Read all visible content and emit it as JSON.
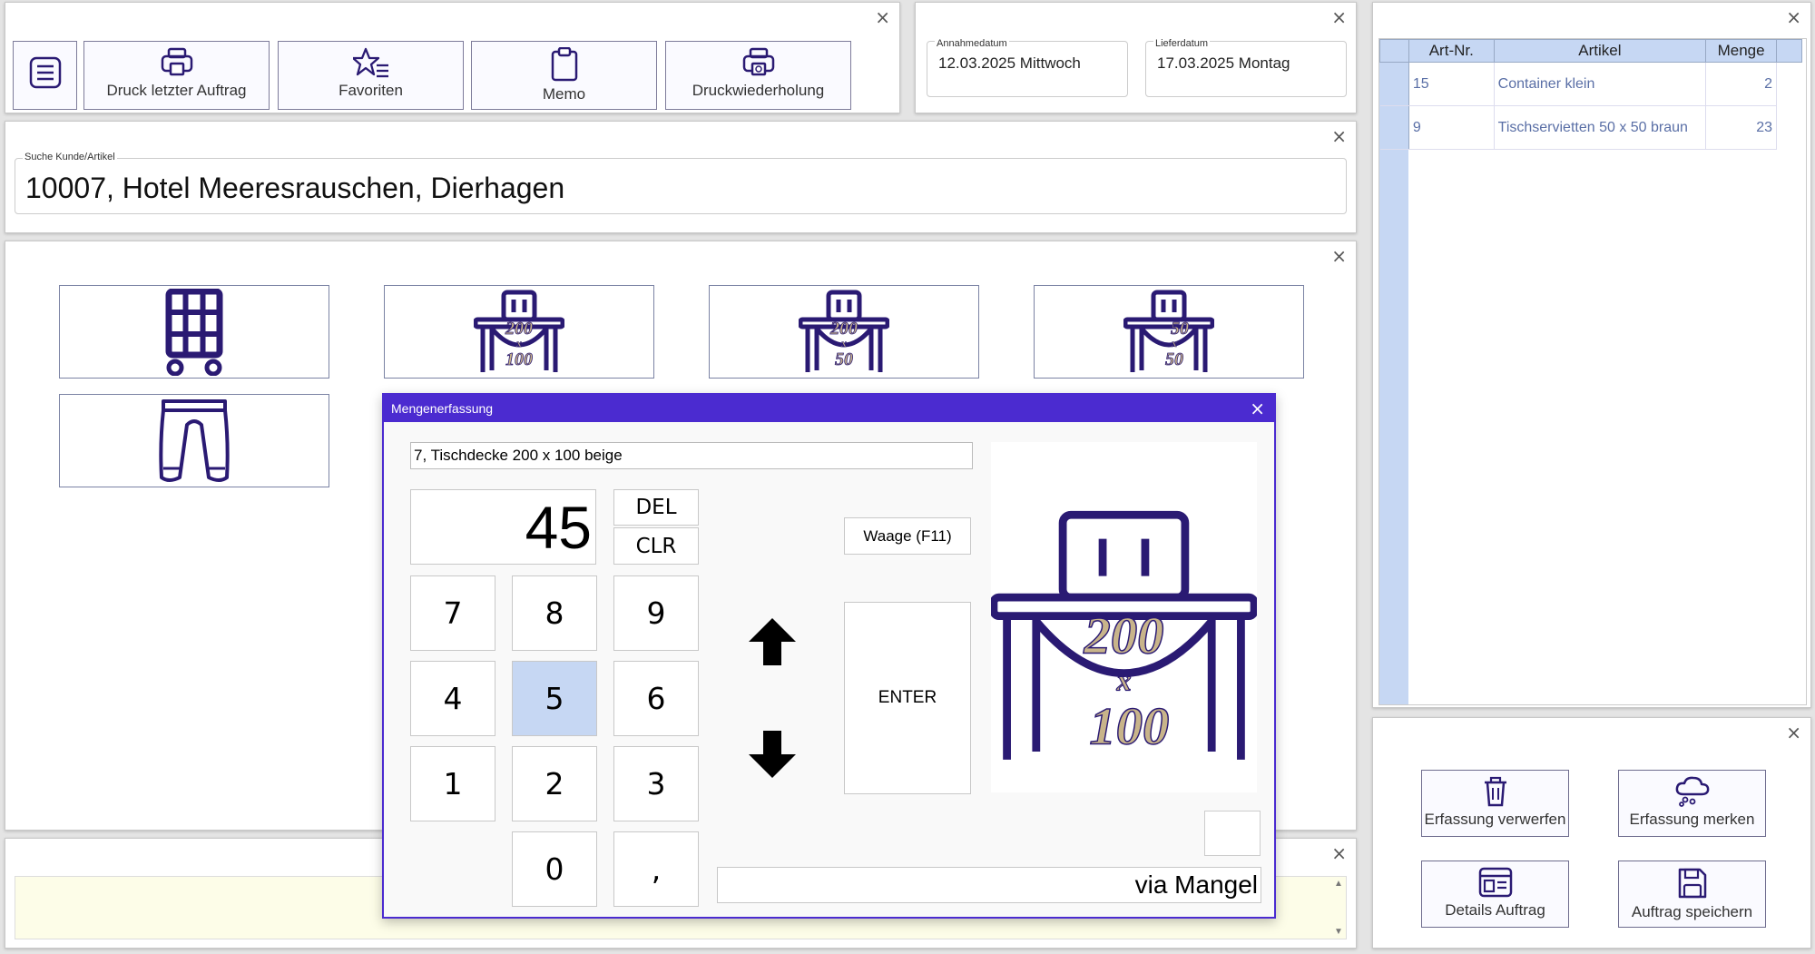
{
  "toolbar": {
    "buttons": [
      {
        "label": "",
        "icon": "menu-icon"
      },
      {
        "label": "Druck letzter Auftrag",
        "icon": "printer-icon"
      },
      {
        "label": "Favoriten",
        "icon": "star-list-icon"
      },
      {
        "label": "Memo",
        "icon": "clipboard-icon"
      },
      {
        "label": "Druckwiederholung",
        "icon": "printer-repeat-icon"
      }
    ]
  },
  "dates": {
    "annahme_caption": "Annahmedatum",
    "annahme_value": "12.03.2025 Mittwoch",
    "liefer_caption": "Lieferdatum",
    "liefer_value": "17.03.2025 Montag"
  },
  "search": {
    "caption": "Suche Kunde/Artikel",
    "value": "10007, Hotel Meeresrauschen, Dierhagen"
  },
  "tiles": [
    {
      "icon": "laundry-cart-icon"
    },
    {
      "icon": "tablecloth-200x100-icon",
      "line1": "200",
      "line2": "x",
      "line3": "100"
    },
    {
      "icon": "tablecloth-200x50-icon",
      "line1": "200",
      "line2": "x",
      "line3": "50"
    },
    {
      "icon": "tablecloth-50x50-icon",
      "line1": "50",
      "line2": "x",
      "line3": "50"
    },
    {
      "icon": "trousers-icon"
    }
  ],
  "dialog": {
    "title": "Mengenerfassung",
    "article": "7, Tischdecke 200 x 100 beige",
    "quantity": "45",
    "del_label": "DEL",
    "clr_label": "CLR",
    "keys": [
      "7",
      "8",
      "9",
      "4",
      "5",
      "6",
      "1",
      "2",
      "3",
      "0",
      ","
    ],
    "scale_label": "Waage (F11)",
    "enter_label": "ENTER",
    "via_text": "via Mangel",
    "preview": {
      "line1": "200",
      "line2": "x",
      "line3": "100"
    }
  },
  "order_table": {
    "headers": [
      "Art-Nr.",
      "Artikel",
      "Menge"
    ],
    "rows": [
      {
        "nr": "15",
        "artikel": "Container klein",
        "menge": "2"
      },
      {
        "nr": "9",
        "artikel": "Tischservietten 50 x 50 braun",
        "menge": "23"
      }
    ]
  },
  "actions": [
    {
      "label": "Erfassung verwerfen",
      "icon": "trash-icon"
    },
    {
      "label": "Erfassung merken",
      "icon": "cloud-save-icon"
    },
    {
      "label": "Details Auftrag",
      "icon": "details-icon"
    },
    {
      "label": "Auftrag speichern",
      "icon": "floppy-disk-icon"
    }
  ],
  "colors": {
    "accent": "#4b2bd0",
    "icon": "#2a1a73",
    "highlight": "#c6d7f3",
    "gold": "#c8b48a",
    "notes_bg": "#fdfde8"
  }
}
